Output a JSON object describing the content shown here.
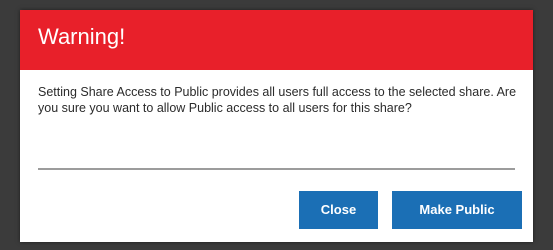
{
  "dialog": {
    "title": "Warning!",
    "message": "Setting Share Access to Public provides all users full access to the selected share. Are you sure you want to allow Public access to all users for this share?",
    "close_label": "Close",
    "make_public_label": "Make Public"
  },
  "colors": {
    "header": "#e8202a",
    "button": "#1b6fb5",
    "backdrop": "#3b3b3b"
  }
}
